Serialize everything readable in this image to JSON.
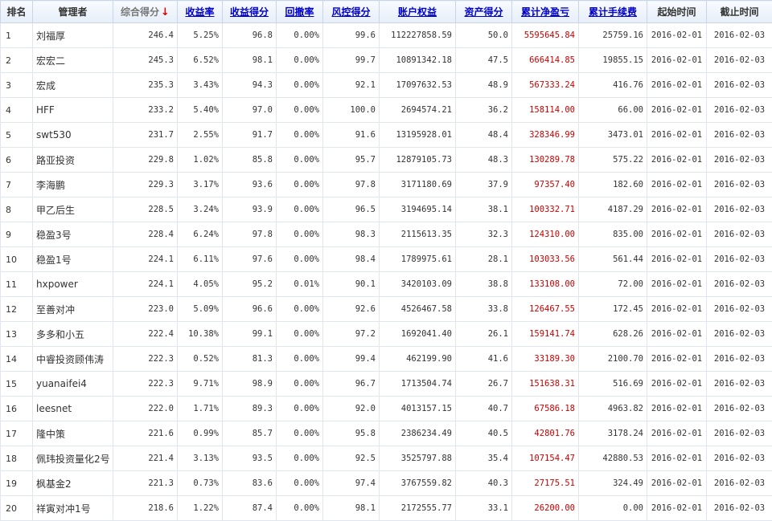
{
  "table": {
    "headers": [
      "排名",
      "管理者",
      "综合得分",
      "收益率",
      "收益得分",
      "回撤率",
      "风控得分",
      "账户权益",
      "资产得分",
      "累计净盈亏",
      "累计手续费",
      "起始时间",
      "截止时间"
    ],
    "sort_arrow": "↓",
    "rows": [
      [
        "1",
        "刘福厚",
        "246.4",
        "5.25%",
        "96.8",
        "0.00%",
        "99.6",
        "112227858.59",
        "50.0",
        "5595645.84",
        "25759.16",
        "2016-02-01",
        "2016-02-03"
      ],
      [
        "2",
        "宏宏二",
        "245.3",
        "6.52%",
        "98.1",
        "0.00%",
        "99.7",
        "10891342.18",
        "47.5",
        "666414.85",
        "19855.15",
        "2016-02-01",
        "2016-02-03"
      ],
      [
        "3",
        "宏成",
        "235.3",
        "3.43%",
        "94.3",
        "0.00%",
        "92.1",
        "17097632.53",
        "48.9",
        "567333.24",
        "416.76",
        "2016-02-01",
        "2016-02-03"
      ],
      [
        "4",
        "HFF",
        "233.2",
        "5.40%",
        "97.0",
        "0.00%",
        "100.0",
        "2694574.21",
        "36.2",
        "158114.00",
        "66.00",
        "2016-02-01",
        "2016-02-03"
      ],
      [
        "5",
        "swt530",
        "231.7",
        "2.55%",
        "91.7",
        "0.00%",
        "91.6",
        "13195928.01",
        "48.4",
        "328346.99",
        "3473.01",
        "2016-02-01",
        "2016-02-03"
      ],
      [
        "6",
        "路亚投资",
        "229.8",
        "1.02%",
        "85.8",
        "0.00%",
        "95.7",
        "12879105.73",
        "48.3",
        "130289.78",
        "575.22",
        "2016-02-01",
        "2016-02-03"
      ],
      [
        "7",
        "李海鹏",
        "229.3",
        "3.17%",
        "93.6",
        "0.00%",
        "97.8",
        "3171180.69",
        "37.9",
        "97357.40",
        "182.60",
        "2016-02-01",
        "2016-02-03"
      ],
      [
        "8",
        "甲乙后生",
        "228.5",
        "3.24%",
        "93.9",
        "0.00%",
        "96.5",
        "3194695.14",
        "38.1",
        "100332.71",
        "4187.29",
        "2016-02-01",
        "2016-02-03"
      ],
      [
        "9",
        "稳盈3号",
        "228.4",
        "6.24%",
        "97.8",
        "0.00%",
        "98.3",
        "2115613.35",
        "32.3",
        "124310.00",
        "835.00",
        "2016-02-01",
        "2016-02-03"
      ],
      [
        "10",
        "稳盈1号",
        "224.1",
        "6.11%",
        "97.6",
        "0.00%",
        "98.4",
        "1789975.61",
        "28.1",
        "103033.56",
        "561.44",
        "2016-02-01",
        "2016-02-03"
      ],
      [
        "11",
        "hxpower",
        "224.1",
        "4.05%",
        "95.2",
        "0.01%",
        "90.1",
        "3420103.09",
        "38.8",
        "133108.00",
        "72.00",
        "2016-02-01",
        "2016-02-03"
      ],
      [
        "12",
        "至善对冲",
        "223.0",
        "5.09%",
        "96.6",
        "0.00%",
        "92.6",
        "4526467.58",
        "33.8",
        "126467.55",
        "172.45",
        "2016-02-01",
        "2016-02-03"
      ],
      [
        "13",
        "多多和小五",
        "222.4",
        "10.38%",
        "99.1",
        "0.00%",
        "97.2",
        "1692041.40",
        "26.1",
        "159141.74",
        "628.26",
        "2016-02-01",
        "2016-02-03"
      ],
      [
        "14",
        "中睿投资顾伟涛",
        "222.3",
        "0.52%",
        "81.3",
        "0.00%",
        "99.4",
        "462199.90",
        "41.6",
        "33189.30",
        "2100.70",
        "2016-02-01",
        "2016-02-03"
      ],
      [
        "15",
        "yuanaifei4",
        "222.3",
        "9.71%",
        "98.9",
        "0.00%",
        "96.7",
        "1713504.74",
        "26.7",
        "151638.31",
        "516.69",
        "2016-02-01",
        "2016-02-03"
      ],
      [
        "16",
        "leesnet",
        "222.0",
        "1.71%",
        "89.3",
        "0.00%",
        "92.0",
        "4013157.15",
        "40.7",
        "67586.18",
        "4963.82",
        "2016-02-01",
        "2016-02-03"
      ],
      [
        "17",
        "隆中策",
        "221.6",
        "0.99%",
        "85.7",
        "0.00%",
        "95.8",
        "2386234.49",
        "40.5",
        "42801.76",
        "3178.24",
        "2016-02-01",
        "2016-02-03"
      ],
      [
        "18",
        "佩玮投资量化2号",
        "221.4",
        "3.13%",
        "93.5",
        "0.00%",
        "92.5",
        "3525797.88",
        "35.4",
        "107154.47",
        "42880.53",
        "2016-02-01",
        "2016-02-03"
      ],
      [
        "19",
        "枫基金2",
        "221.3",
        "0.73%",
        "83.6",
        "0.00%",
        "97.4",
        "3767559.82",
        "40.3",
        "27175.51",
        "324.49",
        "2016-02-01",
        "2016-02-03"
      ],
      [
        "20",
        "祥寅对冲1号",
        "218.6",
        "1.22%",
        "87.4",
        "0.00%",
        "98.1",
        "2172555.77",
        "33.1",
        "26200.00",
        "0.00",
        "2016-02-01",
        "2016-02-03"
      ]
    ]
  },
  "colors": {
    "link": "#0000cc",
    "negative_pnl": "#cc0000",
    "sort_arrow": "#e00000"
  }
}
